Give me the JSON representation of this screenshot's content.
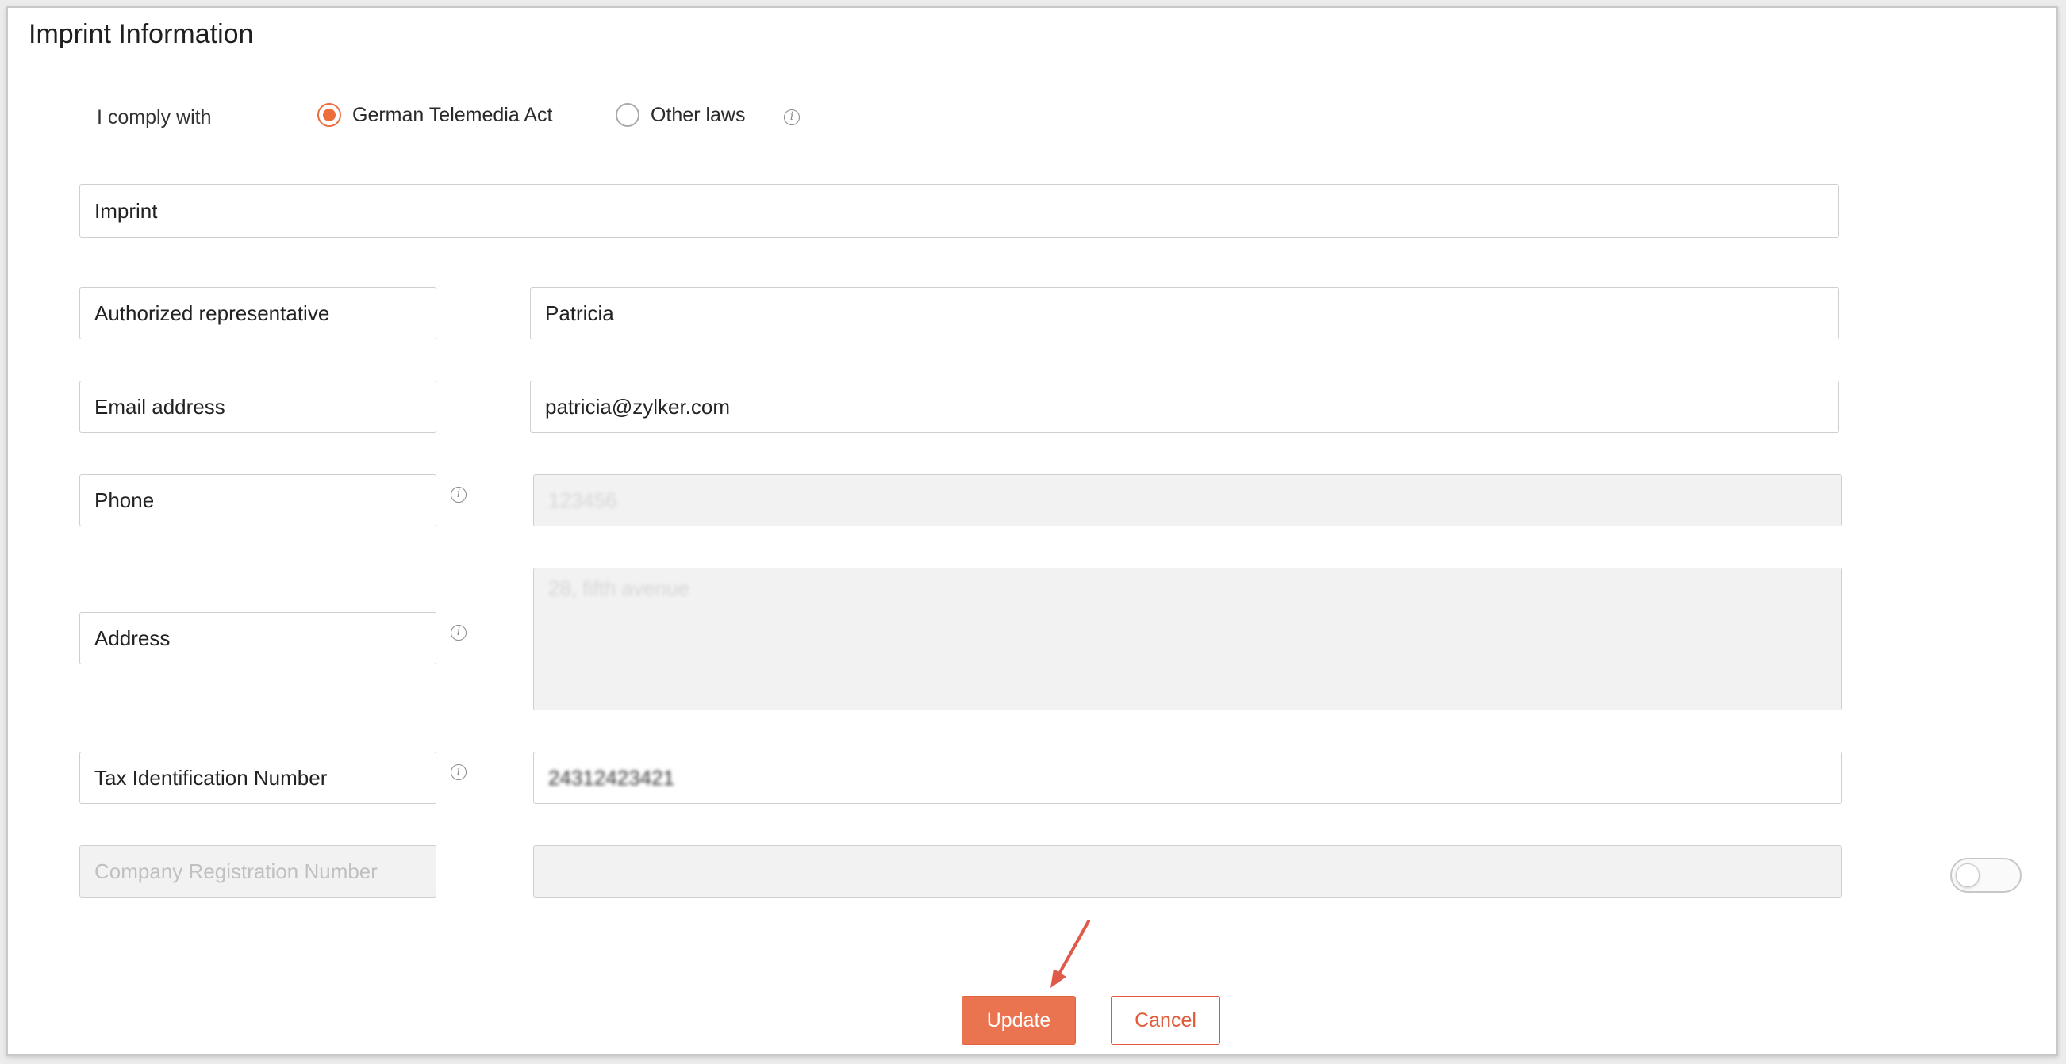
{
  "title": "Imprint Information",
  "comply": {
    "label": "I comply with",
    "options": [
      {
        "label": "German Telemedia Act",
        "selected": true
      },
      {
        "label": "Other laws",
        "selected": false
      }
    ]
  },
  "imprint_heading": "Imprint",
  "fields": [
    {
      "label": "Authorized representative",
      "value": "Patricia"
    },
    {
      "label": "Email address",
      "value": "patricia@zylker.com"
    },
    {
      "label": "Phone",
      "value": "123456"
    },
    {
      "label": "Address",
      "value": "28, fifth avenue"
    },
    {
      "label": "Tax Identification Number",
      "value": "24312423421"
    },
    {
      "label": "Company Registration Number",
      "value": "",
      "enabled": false
    }
  ],
  "icons": {
    "info": "info-icon",
    "arrow": "annotation-arrow"
  },
  "colors": {
    "accent": "#ea7350",
    "radio": "#ee6d3c",
    "arrow": "#e05a4a"
  },
  "buttons": {
    "update": "Update",
    "cancel": "Cancel"
  }
}
